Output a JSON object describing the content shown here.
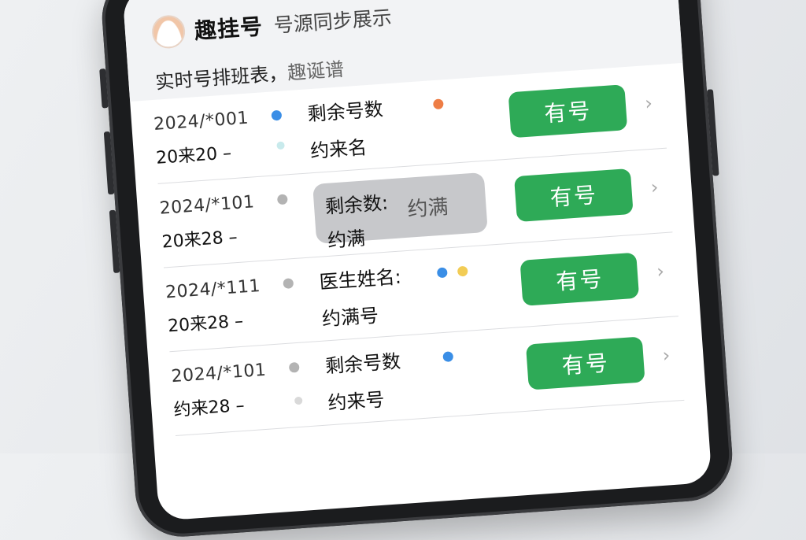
{
  "header": {
    "title": "趣挂号",
    "subtitle": "号源同步展示",
    "schedule_label": "实时号排班表，",
    "schedule_sub": "趣诞谱"
  },
  "rows": [
    {
      "date": "2024/*001",
      "time": "20来20 –",
      "info_line1": "剩余号数",
      "info_line2": "约来名",
      "button_label": "有号",
      "dot_colors": [
        "#3a8ee6",
        "#ee7d45",
        "#c8eaec"
      ]
    },
    {
      "date": "2024/*101",
      "time": "20来28 –",
      "info_line1": "剩余数:",
      "info_line2": "约满",
      "info_tag": "约满",
      "button_label": "有号",
      "dot_colors": [
        "#b3b3b3"
      ]
    },
    {
      "date": "2024/*111",
      "time": "20来28 –",
      "info_line1": "医生姓名:",
      "info_line2": "约满号",
      "button_label": "有号",
      "dot_colors": [
        "#b3b3b3",
        "#3a8ee6",
        "#f2cc55"
      ]
    },
    {
      "date": "2024/*101",
      "time": "约来28 –",
      "info_line1": "剩余号数",
      "info_line2": "约来号",
      "button_label": "有号",
      "dot_colors": [
        "#b3b3b3",
        "#3a8ee6",
        "#d9d9d9"
      ]
    }
  ]
}
